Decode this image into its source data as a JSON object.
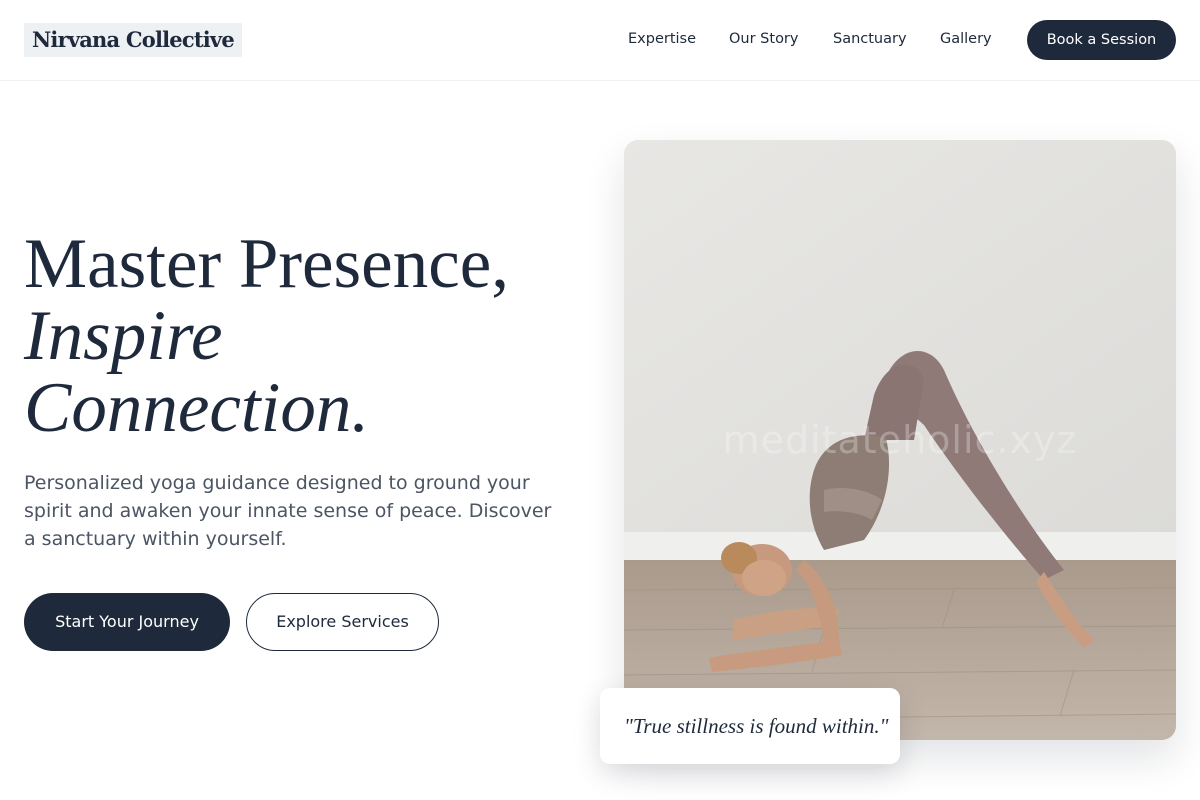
{
  "navbar": {
    "brand": "Nirvana Collective",
    "links": [
      "Expertise",
      "Our Story",
      "Sanctuary",
      "Gallery"
    ],
    "cta_label": "Book a Session"
  },
  "hero": {
    "title_line1": "Master Presence,",
    "title_line2": "Inspire",
    "title_line3": "Connection.",
    "description": "Personalized yoga guidance designed to ground your spirit and awaken your innate sense of peace. Discover a sanctuary within yourself.",
    "primary_button": "Start Your Journey",
    "secondary_button": "Explore Services"
  },
  "image": {
    "watermark": "meditateholic.xyz"
  },
  "quote": {
    "text": "\"True stillness is found within.\""
  },
  "colors": {
    "primary": "#1e293b",
    "text_muted": "#4b5563",
    "background": "#ffffff"
  }
}
